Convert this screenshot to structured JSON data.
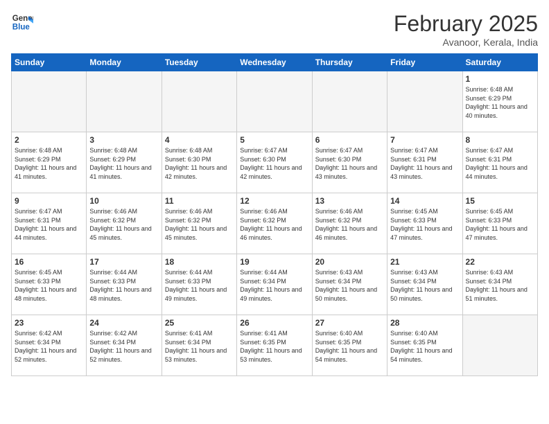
{
  "header": {
    "logo_line1": "General",
    "logo_line2": "Blue",
    "month": "February 2025",
    "location": "Avanoor, Kerala, India"
  },
  "weekdays": [
    "Sunday",
    "Monday",
    "Tuesday",
    "Wednesday",
    "Thursday",
    "Friday",
    "Saturday"
  ],
  "weeks": [
    [
      {
        "day": "",
        "info": ""
      },
      {
        "day": "",
        "info": ""
      },
      {
        "day": "",
        "info": ""
      },
      {
        "day": "",
        "info": ""
      },
      {
        "day": "",
        "info": ""
      },
      {
        "day": "",
        "info": ""
      },
      {
        "day": "1",
        "info": "Sunrise: 6:48 AM\nSunset: 6:29 PM\nDaylight: 11 hours and 40 minutes."
      }
    ],
    [
      {
        "day": "2",
        "info": "Sunrise: 6:48 AM\nSunset: 6:29 PM\nDaylight: 11 hours and 41 minutes."
      },
      {
        "day": "3",
        "info": "Sunrise: 6:48 AM\nSunset: 6:29 PM\nDaylight: 11 hours and 41 minutes."
      },
      {
        "day": "4",
        "info": "Sunrise: 6:48 AM\nSunset: 6:30 PM\nDaylight: 11 hours and 42 minutes."
      },
      {
        "day": "5",
        "info": "Sunrise: 6:47 AM\nSunset: 6:30 PM\nDaylight: 11 hours and 42 minutes."
      },
      {
        "day": "6",
        "info": "Sunrise: 6:47 AM\nSunset: 6:30 PM\nDaylight: 11 hours and 43 minutes."
      },
      {
        "day": "7",
        "info": "Sunrise: 6:47 AM\nSunset: 6:31 PM\nDaylight: 11 hours and 43 minutes."
      },
      {
        "day": "8",
        "info": "Sunrise: 6:47 AM\nSunset: 6:31 PM\nDaylight: 11 hours and 44 minutes."
      }
    ],
    [
      {
        "day": "9",
        "info": "Sunrise: 6:47 AM\nSunset: 6:31 PM\nDaylight: 11 hours and 44 minutes."
      },
      {
        "day": "10",
        "info": "Sunrise: 6:46 AM\nSunset: 6:32 PM\nDaylight: 11 hours and 45 minutes."
      },
      {
        "day": "11",
        "info": "Sunrise: 6:46 AM\nSunset: 6:32 PM\nDaylight: 11 hours and 45 minutes."
      },
      {
        "day": "12",
        "info": "Sunrise: 6:46 AM\nSunset: 6:32 PM\nDaylight: 11 hours and 46 minutes."
      },
      {
        "day": "13",
        "info": "Sunrise: 6:46 AM\nSunset: 6:32 PM\nDaylight: 11 hours and 46 minutes."
      },
      {
        "day": "14",
        "info": "Sunrise: 6:45 AM\nSunset: 6:33 PM\nDaylight: 11 hours and 47 minutes."
      },
      {
        "day": "15",
        "info": "Sunrise: 6:45 AM\nSunset: 6:33 PM\nDaylight: 11 hours and 47 minutes."
      }
    ],
    [
      {
        "day": "16",
        "info": "Sunrise: 6:45 AM\nSunset: 6:33 PM\nDaylight: 11 hours and 48 minutes."
      },
      {
        "day": "17",
        "info": "Sunrise: 6:44 AM\nSunset: 6:33 PM\nDaylight: 11 hours and 48 minutes."
      },
      {
        "day": "18",
        "info": "Sunrise: 6:44 AM\nSunset: 6:33 PM\nDaylight: 11 hours and 49 minutes."
      },
      {
        "day": "19",
        "info": "Sunrise: 6:44 AM\nSunset: 6:34 PM\nDaylight: 11 hours and 49 minutes."
      },
      {
        "day": "20",
        "info": "Sunrise: 6:43 AM\nSunset: 6:34 PM\nDaylight: 11 hours and 50 minutes."
      },
      {
        "day": "21",
        "info": "Sunrise: 6:43 AM\nSunset: 6:34 PM\nDaylight: 11 hours and 50 minutes."
      },
      {
        "day": "22",
        "info": "Sunrise: 6:43 AM\nSunset: 6:34 PM\nDaylight: 11 hours and 51 minutes."
      }
    ],
    [
      {
        "day": "23",
        "info": "Sunrise: 6:42 AM\nSunset: 6:34 PM\nDaylight: 11 hours and 52 minutes."
      },
      {
        "day": "24",
        "info": "Sunrise: 6:42 AM\nSunset: 6:34 PM\nDaylight: 11 hours and 52 minutes."
      },
      {
        "day": "25",
        "info": "Sunrise: 6:41 AM\nSunset: 6:34 PM\nDaylight: 11 hours and 53 minutes."
      },
      {
        "day": "26",
        "info": "Sunrise: 6:41 AM\nSunset: 6:35 PM\nDaylight: 11 hours and 53 minutes."
      },
      {
        "day": "27",
        "info": "Sunrise: 6:40 AM\nSunset: 6:35 PM\nDaylight: 11 hours and 54 minutes."
      },
      {
        "day": "28",
        "info": "Sunrise: 6:40 AM\nSunset: 6:35 PM\nDaylight: 11 hours and 54 minutes."
      },
      {
        "day": "",
        "info": ""
      }
    ]
  ]
}
